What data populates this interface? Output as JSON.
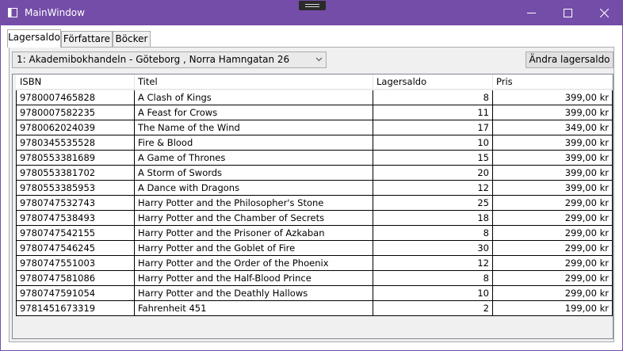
{
  "window": {
    "title": "MainWindow",
    "accent_color": "#744da9",
    "title_icon": "window-app-icon",
    "controls": [
      "minimize-icon",
      "maximize-icon",
      "close-icon"
    ]
  },
  "tabs": [
    {
      "label": "Lagersaldo",
      "active": true
    },
    {
      "label": "Författare",
      "active": false
    },
    {
      "label": "Böcker",
      "active": false
    }
  ],
  "store_select": {
    "selected": "1:  Akademibokhandeln  -  Göteborg ,  Norra Hamngatan 26"
  },
  "update_button": {
    "label": "Ändra lagersaldo"
  },
  "grid": {
    "columns": [
      "ISBN",
      "Titel",
      "Lagersaldo",
      "Pris"
    ],
    "rows": [
      {
        "isbn": "9780007465828",
        "title": "A Clash of Kings",
        "stock": "8",
        "price": "399,00 kr"
      },
      {
        "isbn": "9780007582235",
        "title": "A Feast for Crows",
        "stock": "11",
        "price": "399,00 kr"
      },
      {
        "isbn": "9780062024039",
        "title": "The Name of the Wind",
        "stock": "17",
        "price": "349,00 kr"
      },
      {
        "isbn": "9780345535528",
        "title": "Fire & Blood",
        "stock": "10",
        "price": "399,00 kr"
      },
      {
        "isbn": "9780553381689",
        "title": "A Game of Thrones",
        "stock": "15",
        "price": "399,00 kr"
      },
      {
        "isbn": "9780553381702",
        "title": "A Storm of Swords",
        "stock": "20",
        "price": "399,00 kr"
      },
      {
        "isbn": "9780553385953",
        "title": "A Dance with Dragons",
        "stock": "12",
        "price": "399,00 kr"
      },
      {
        "isbn": "9780747532743",
        "title": "Harry Potter and the Philosopher's Stone",
        "stock": "25",
        "price": "299,00 kr"
      },
      {
        "isbn": "9780747538493",
        "title": "Harry Potter and the Chamber of Secrets",
        "stock": "18",
        "price": "299,00 kr"
      },
      {
        "isbn": "9780747542155",
        "title": "Harry Potter and the Prisoner of Azkaban",
        "stock": "8",
        "price": "299,00 kr"
      },
      {
        "isbn": "9780747546245",
        "title": "Harry Potter and the Goblet of Fire",
        "stock": "30",
        "price": "299,00 kr"
      },
      {
        "isbn": "9780747551003",
        "title": "Harry Potter and the Order of the Phoenix",
        "stock": "12",
        "price": "299,00 kr"
      },
      {
        "isbn": "9780747581086",
        "title": "Harry Potter and the Half-Blood Prince",
        "stock": "8",
        "price": "299,00 kr"
      },
      {
        "isbn": "9780747591054",
        "title": "Harry Potter and the Deathly Hallows",
        "stock": "10",
        "price": "299,00 kr"
      },
      {
        "isbn": "9781451673319",
        "title": "Fahrenheit 451",
        "stock": "2",
        "price": "199,00 kr"
      }
    ]
  }
}
